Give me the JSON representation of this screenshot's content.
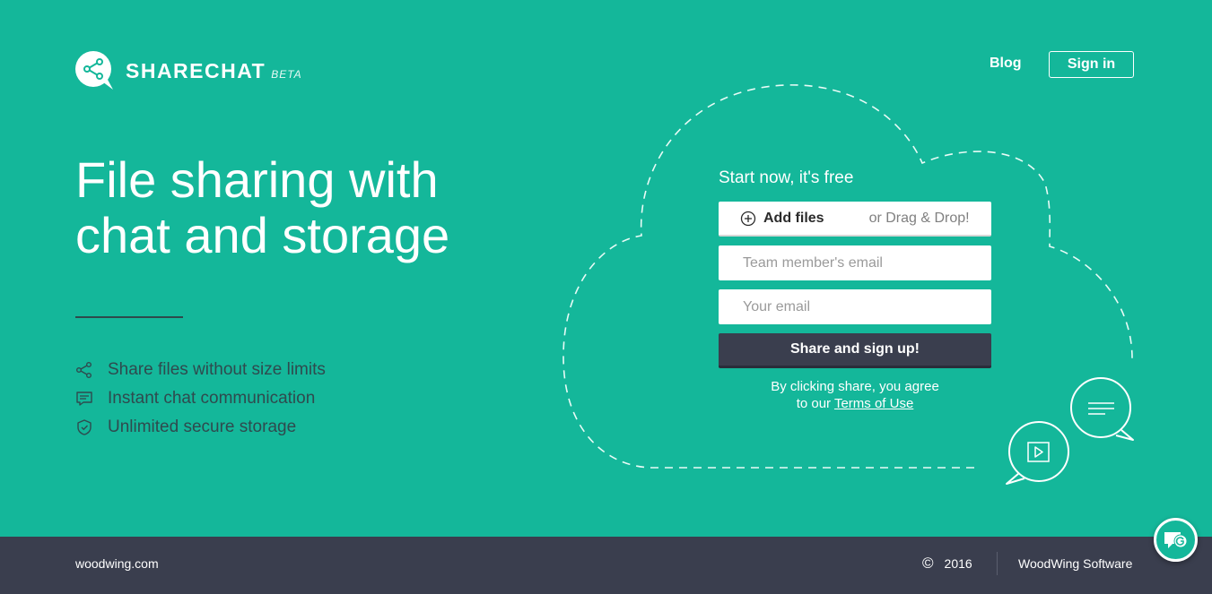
{
  "brand": {
    "name": "SHARECHAT",
    "tag": "BETA",
    "logo_icon": "share-bubble-icon"
  },
  "nav": {
    "blog": "Blog",
    "signin": "Sign in"
  },
  "hero": {
    "headline": "File sharing with chat and storage",
    "features": [
      {
        "icon": "share-icon",
        "label": "Share files without size limits"
      },
      {
        "icon": "chat-icon",
        "label": "Instant chat communication"
      },
      {
        "icon": "shield-icon",
        "label": "Unlimited secure storage"
      }
    ]
  },
  "form": {
    "title": "Start now, it's free",
    "add_files": "Add files",
    "drag_drop": "or Drag & Drop!",
    "team_email_placeholder": "Team member's email",
    "your_email_placeholder": "Your email",
    "submit": "Share and sign up!",
    "terms_prefix": "By clicking share, you agree",
    "terms_middle": "to our",
    "terms_link": "Terms of Use"
  },
  "footer": {
    "site": "woodwing.com",
    "copyright_symbol": "©",
    "year": "2016",
    "company": "WoodWing Software"
  },
  "colors": {
    "accent": "#14b79a",
    "dark": "#3a3e4e",
    "text_dark": "#2f4a4e"
  }
}
